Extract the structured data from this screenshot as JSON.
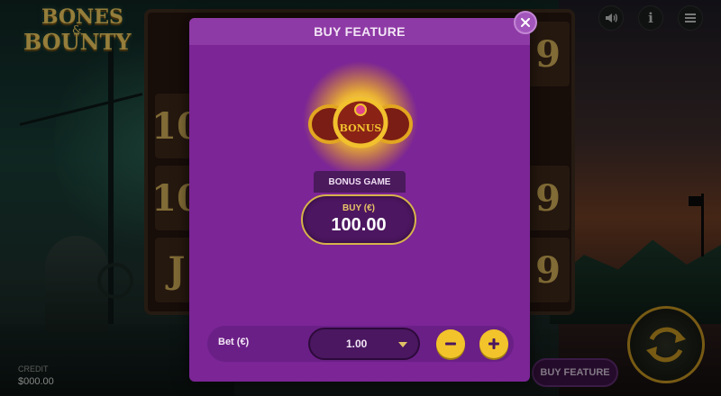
{
  "game": {
    "logo_line1": "BONES",
    "logo_amp": "&",
    "logo_line2": "BOUNTY"
  },
  "top_controls": {
    "sound_icon": "speaker-icon",
    "info_label": "i",
    "menu_icon": "hamburger-icon"
  },
  "credit": {
    "label": "CREDIT",
    "value": "$000.00"
  },
  "reels_visible_symbols": [
    "10",
    "10",
    "J",
    "9",
    "9",
    "9"
  ],
  "buy_feature_button_label": "BUY FEATURE",
  "modal": {
    "title": "BUY FEATURE",
    "feature_name": "BONUS GAME",
    "coin_text": "BONUS",
    "buy_label": "BUY (€)",
    "buy_price": "100.00",
    "bet_label": "Bet (€)",
    "bet_value": "1.00"
  },
  "colors": {
    "modal_bg": "#7b2596",
    "accent_gold": "#f2c32a",
    "button_border": "#d7b34a"
  }
}
